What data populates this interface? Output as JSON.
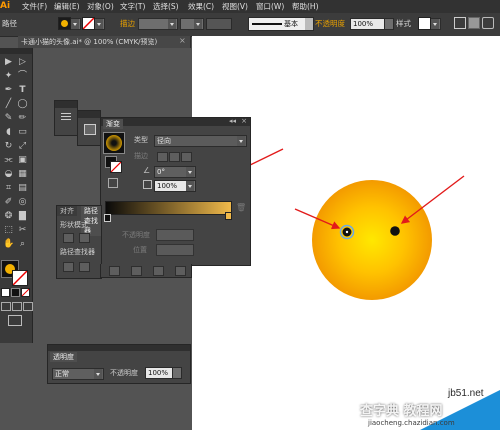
{
  "app": {
    "logo": "Ai"
  },
  "menubar": {
    "items": [
      "文件(F)",
      "编辑(E)",
      "对象(O)",
      "文字(T)",
      "选择(S)",
      "效果(C)",
      "视图(V)",
      "窗口(W)",
      "帮助(H)"
    ]
  },
  "controlbar": {
    "path_label": "路径",
    "stroke_label": "描边",
    "stroke_style": "基本",
    "opacity_label": "不透明度",
    "opacity_value": "100%",
    "style_label": "样式"
  },
  "document": {
    "tab_title": "卡通小猫的头像.ai* @ 100% (CMYK/预览)",
    "close_icon": "×"
  },
  "gradient_panel": {
    "tab": "渐变",
    "type_label": "类型",
    "type_value": "径向",
    "stroke_label": "描边",
    "angle_value": "0°",
    "aspect_value": "100%",
    "opacity_label": "不透明度",
    "location_label": "位置",
    "colors": {
      "start": "#0a0a0a",
      "end": "#f0b94a"
    }
  },
  "pathfinder_panel": {
    "tabs": [
      "对齐",
      "路径查找器"
    ],
    "shape_modes_label": "形状模式",
    "pathfinders_label": "路径查找器"
  },
  "transparency_panel": {
    "tab": "透明度",
    "mode_value": "正常",
    "opacity_label": "不透明度",
    "opacity_value": "100%"
  },
  "canvas": {
    "sun_colors": {
      "center": "#ffe800",
      "mid": "#ffc200",
      "edge": "#f39a00"
    },
    "arrow_color": "#e21a1a"
  },
  "watermark": {
    "site": "jb51.net",
    "text": "查字典 教程网",
    "url": "jiaocheng.chazidian.com"
  }
}
